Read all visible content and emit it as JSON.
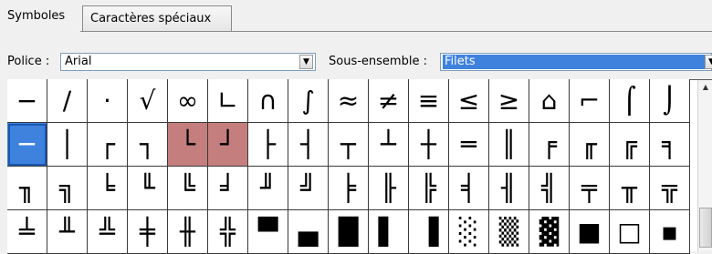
{
  "tabs": [
    {
      "label": "Symboles",
      "active": true
    },
    {
      "label": "Caractères spéciaux",
      "active": false
    }
  ],
  "font": {
    "label": "Police :",
    "value": "Arial"
  },
  "subset": {
    "label": "Sous-ensemble :",
    "value": "Filets"
  },
  "glyphs": [
    [
      "−",
      "∕",
      "·",
      "√",
      "∞",
      "∟",
      "∩",
      "∫",
      "≈",
      "≠",
      "≡",
      "≤",
      "≥",
      "⌂",
      "⌐",
      "⌠",
      "⌡"
    ],
    [
      "─",
      "│",
      "┌",
      "┐",
      "└",
      "┘",
      "├",
      "┤",
      "┬",
      "┴",
      "┼",
      "═",
      "║",
      "╒",
      "╓",
      "╔",
      "╕"
    ],
    [
      "╖",
      "╗",
      "╘",
      "╙",
      "╚",
      "╛",
      "╜",
      "╝",
      "╞",
      "╟",
      "╠",
      "╡",
      "╢",
      "╣",
      "╤",
      "╥",
      "╦"
    ],
    [
      "╧",
      "╨",
      "╩",
      "╪",
      "╫",
      "╬",
      "▀",
      "▄",
      "█",
      "▌",
      "▐",
      "░",
      "▒",
      "▓",
      "■",
      "□",
      "▪"
    ]
  ],
  "selected_glyph": "─",
  "highlighted_glyphs": [
    "└",
    "┘"
  ],
  "colors": {
    "selection": "#3e82de",
    "highlight": "#c47e7e"
  },
  "icons": {
    "dropdown": "chevron-down-icon",
    "scroll_up": "arrow-up-icon"
  }
}
